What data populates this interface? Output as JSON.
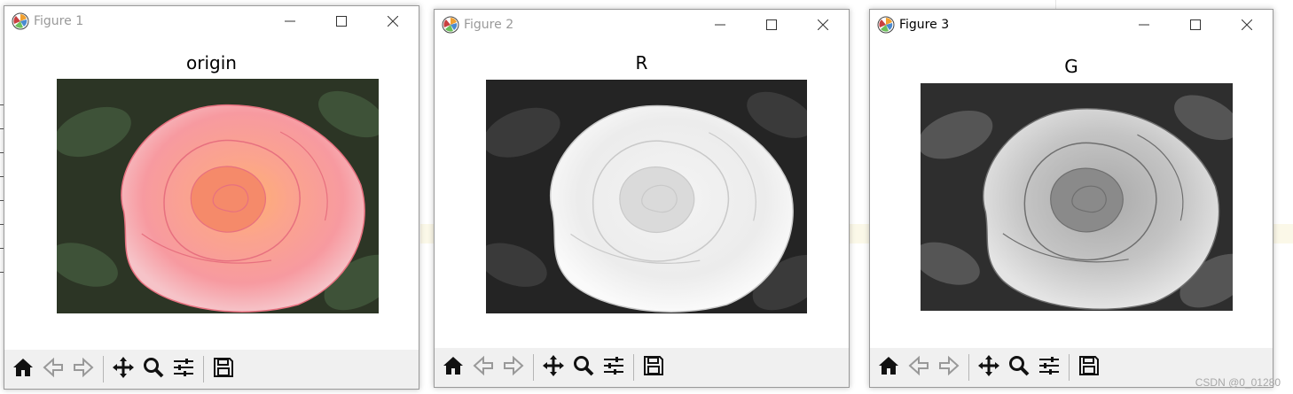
{
  "windows": [
    {
      "title": "Figure 1",
      "plot_title": "origin",
      "active": false,
      "image_variant": "color"
    },
    {
      "title": "Figure 2",
      "plot_title": "R",
      "active": false,
      "image_variant": "gray-bright"
    },
    {
      "title": "Figure 3",
      "plot_title": "G",
      "active": true,
      "image_variant": "gray"
    }
  ],
  "toolbar": {
    "buttons": [
      "home-icon",
      "back-arrow-icon",
      "forward-arrow-icon",
      "pan-icon",
      "zoom-icon",
      "configure-subplots-icon",
      "save-icon"
    ]
  },
  "caption_buttons": [
    "minimize-icon",
    "maximize-icon",
    "close-icon"
  ],
  "watermark": "CSDN @0_01280",
  "colors": {
    "toolbar_bg": "#f0f0f0",
    "inactive_title": "#999999",
    "active_title": "#000000",
    "icon": "#111111"
  }
}
